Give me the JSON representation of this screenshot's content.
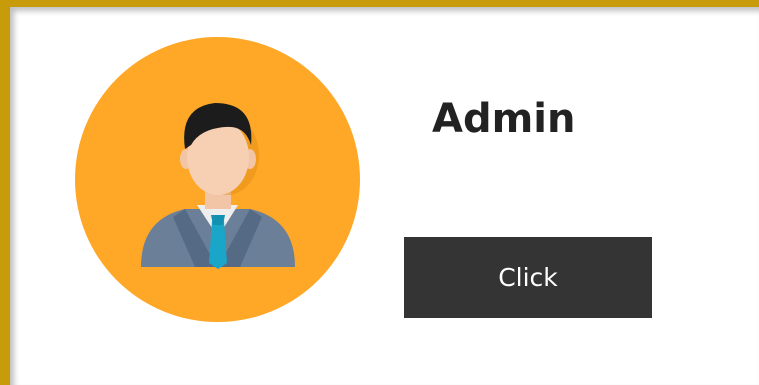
{
  "profile": {
    "name": "Admin",
    "avatar_icon": "admin-avatar-icon",
    "avatar_bg": "#ffa726"
  },
  "actions": {
    "click_label": "Click",
    "button_bg": "#343434"
  }
}
